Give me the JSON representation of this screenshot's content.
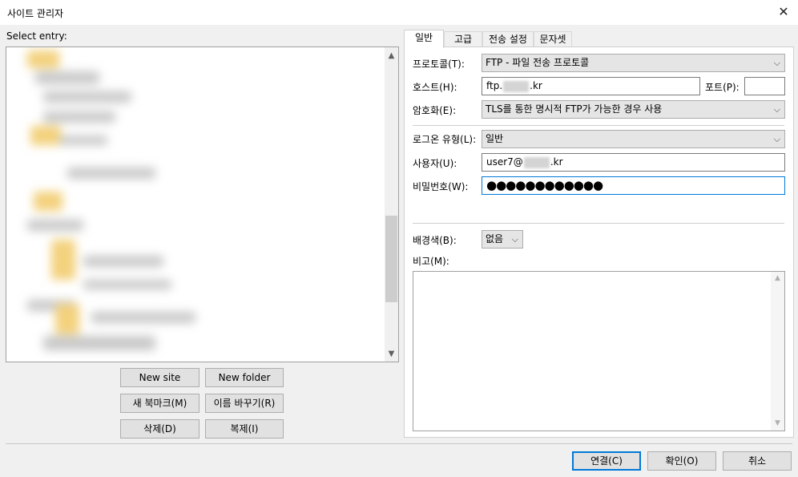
{
  "window": {
    "title": "사이트 관리자",
    "close_glyph": "✕"
  },
  "left": {
    "select_label": "Select entry:",
    "buttons": {
      "new_site": "New site",
      "new_folder": "New folder",
      "new_bookmark": "새 북마크(M)",
      "rename": "이름 바꾸기(R)",
      "delete": "삭제(D)",
      "duplicate": "복제(I)"
    }
  },
  "tabs": [
    {
      "label": "일반",
      "active": true
    },
    {
      "label": "고급",
      "active": false
    },
    {
      "label": "전송 설정",
      "active": false
    },
    {
      "label": "문자셋",
      "active": false
    }
  ],
  "general": {
    "protocol": {
      "label": "프로토콜(T):",
      "value": "FTP - 파일 전송 프로토콜"
    },
    "host": {
      "label": "호스트(H):",
      "value_prefix": "ftp.",
      "value_suffix": ".kr"
    },
    "port": {
      "label": "포트(P):",
      "value": ""
    },
    "encryption": {
      "label": "암호화(E):",
      "value": "TLS를 통한 명시적 FTP가 가능한 경우 사용"
    },
    "logon_type": {
      "label": "로그온 유형(L):",
      "value": "일반"
    },
    "user": {
      "label": "사용자(U):",
      "value_prefix": "user7@",
      "value_suffix": ".kr"
    },
    "password": {
      "label": "비밀번호(W):",
      "value": "●●●●●●●●●●●●"
    },
    "background": {
      "label": "배경색(B):",
      "value": "없음"
    },
    "comments": {
      "label": "비고(M):",
      "value": ""
    }
  },
  "footer": {
    "connect": "연결(C)",
    "ok": "확인(O)",
    "cancel": "취소"
  },
  "icons": {
    "chevron_down": "⌵",
    "scroll_up": "▲",
    "scroll_down": "▼"
  }
}
